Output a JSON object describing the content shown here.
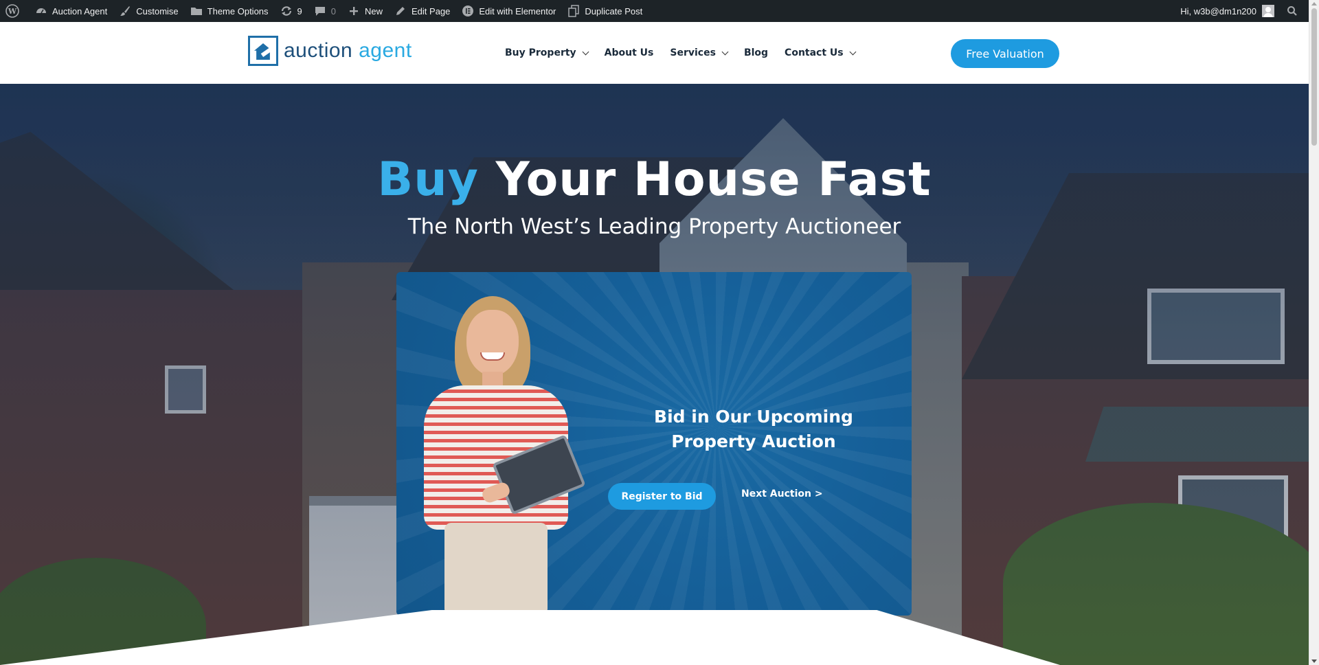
{
  "admin_bar": {
    "site_name": "Auction Agent",
    "customise": "Customise",
    "theme_options": "Theme Options",
    "updates_count": "9",
    "comments_count": "0",
    "new": "New",
    "edit_page": "Edit Page",
    "edit_elementor": "Edit with Elementor",
    "duplicate_post": "Duplicate Post",
    "greeting": "Hi, w3b@dm1n200"
  },
  "logo": {
    "part1": "auction",
    "part2": " agent"
  },
  "nav": {
    "items": [
      {
        "label": "Buy Property",
        "dropdown": true
      },
      {
        "label": "About Us",
        "dropdown": false
      },
      {
        "label": "Services",
        "dropdown": true
      },
      {
        "label": "Blog",
        "dropdown": false
      },
      {
        "label": "Contact Us",
        "dropdown": true
      }
    ],
    "cta": "Free Valuation"
  },
  "hero": {
    "title_accent": "Buy",
    "title_rest": " Your House Fast",
    "subtitle": "The North West’s Leading Property Auctioneer"
  },
  "card": {
    "title": "Bid in Our Upcoming Property Auction",
    "register_button": "Register to Bid",
    "next_link": "Next Auction >"
  },
  "colors": {
    "accent": "#1e9be0",
    "admin_bar_bg": "#1d2327",
    "card_bg": "#155f98"
  }
}
